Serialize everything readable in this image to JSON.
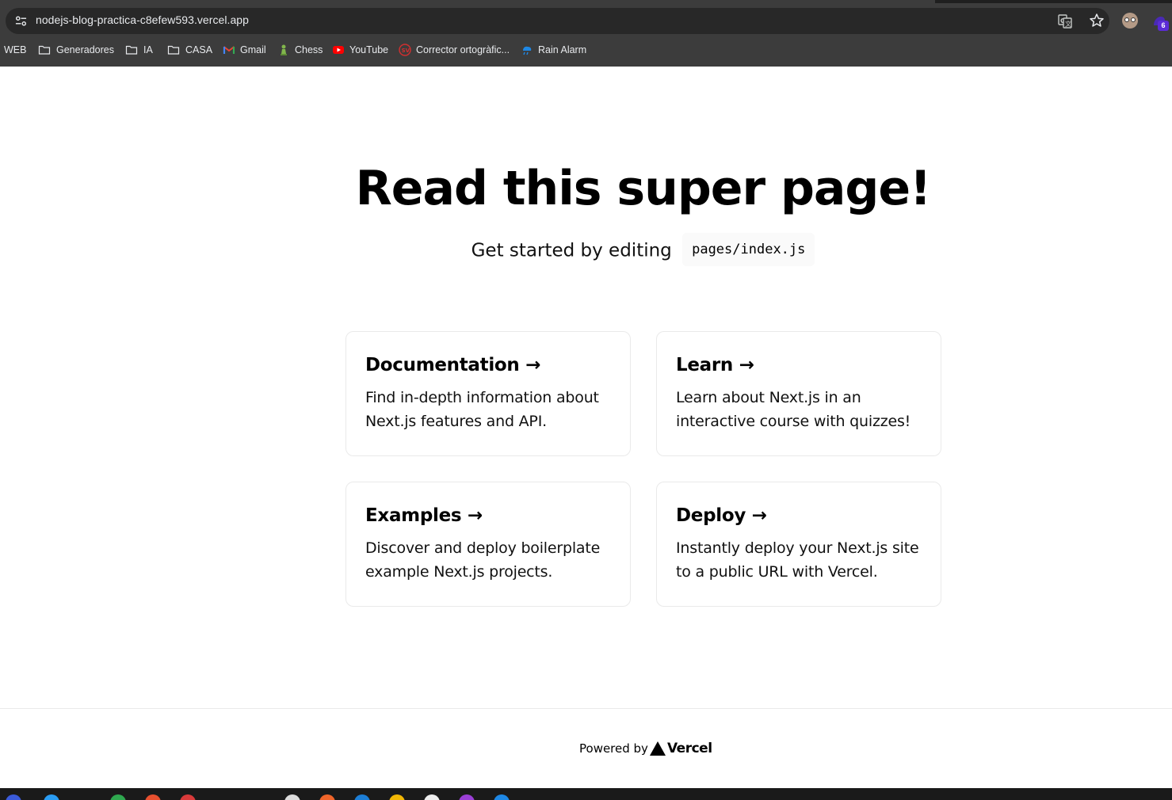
{
  "browser": {
    "url": "nodejs-blog-practica-c8efew593.vercel.app",
    "extension_badge_count": "6",
    "bookmarks": [
      {
        "label": "WEB",
        "icon": "none"
      },
      {
        "label": "Generadores",
        "icon": "folder-icon"
      },
      {
        "label": "IA",
        "icon": "folder-icon"
      },
      {
        "label": "CASA",
        "icon": "folder-icon"
      },
      {
        "label": "Gmail",
        "icon": "gmail-icon"
      },
      {
        "label": "Chess",
        "icon": "chess-pawn-icon"
      },
      {
        "label": "YouTube",
        "icon": "youtube-icon"
      },
      {
        "label": "Corrector ortogràfic...",
        "icon": "corrector-icon"
      },
      {
        "label": "Rain Alarm",
        "icon": "rain-alarm-icon"
      }
    ]
  },
  "hero": {
    "title": "Read this super page!",
    "subtitle": "Get started by editing",
    "code": "pages/index.js"
  },
  "cards": [
    {
      "title": "Documentation →",
      "text": "Find in-depth information about Next.js features and API."
    },
    {
      "title": "Learn →",
      "text": "Learn about Next.js in an interactive course with quizzes!"
    },
    {
      "title": "Examples →",
      "text": "Discover and deploy boilerplate example Next.js projects."
    },
    {
      "title": "Deploy →",
      "text": "Instantly deploy your Next.js site to a public URL with Vercel."
    }
  ],
  "footer": {
    "powered_by": "Powered by",
    "brand": "Vercel"
  },
  "colors": {
    "chrome_bg": "#3c3c3c",
    "omnibox_bg": "#282828",
    "card_border": "#eaeaea",
    "code_bg": "#fafafa"
  }
}
